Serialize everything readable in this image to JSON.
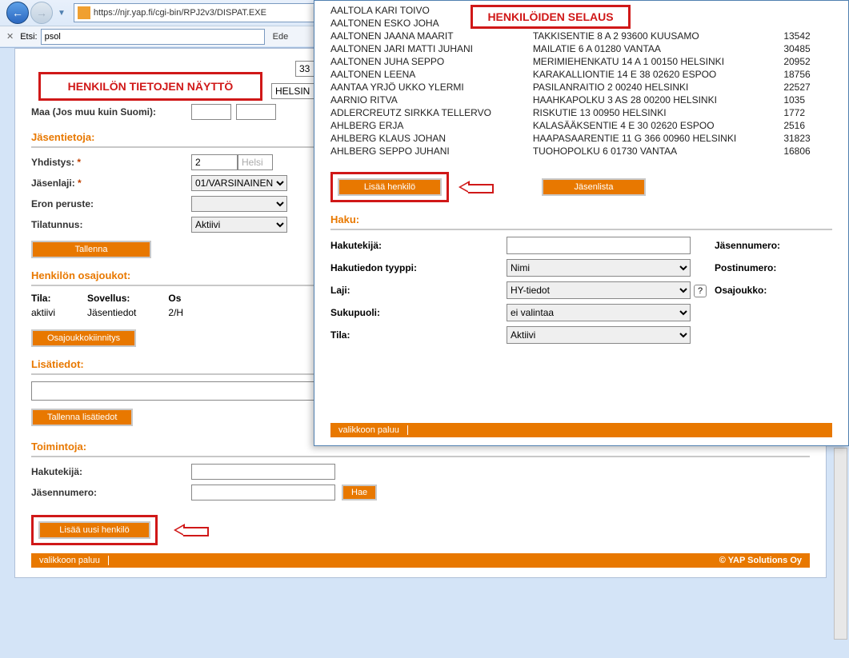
{
  "browser": {
    "url": "https://njr.yap.fi/cgi-bin/RPJ2v3/DISPAT.EXE",
    "find_label": "Etsi:",
    "find_value": "psol",
    "find_next": "Ede"
  },
  "callouts": {
    "left": "HENKILÖN TIETOJEN NÄYTTÖ",
    "right": "HENKILÖIDEN SELAUS"
  },
  "left": {
    "value33": "33",
    "valueHelsinki": "HELSIN",
    "maa_label": "Maa (Jos muu kuin Suomi):",
    "jasentietoja": "Jäsentietoja:",
    "yhdistys_label": "Yhdistys:",
    "yhdistys_value": "2",
    "yhdistys_hint": "Helsi",
    "jasenlaji_label": "Jäsenlaji:",
    "jasenlaji_value": "01/VARSINAINEN",
    "eron_label": "Eron peruste:",
    "tilatunnus_label": "Tilatunnus:",
    "tilatunnus_value": "Aktiivi",
    "tallenna": "Tallenna",
    "osajoukot": "Henkilön osajoukot:",
    "tila_h": "Tila:",
    "tila_v": "aktiivi",
    "sovellus_h": "Sovellus:",
    "sovellus_v": "Jäsentiedot",
    "os_h": "Os",
    "os_v": "2/H",
    "osajoukkokiinnitys": "Osajoukkokiinnitys",
    "lisatiedot": "Lisätiedot:",
    "tallenna_lisa": "Tallenna lisätiedot",
    "toimintoja": "Toimintoja:",
    "hakutekija": "Hakutekijä:",
    "jasennumero": "Jäsennumero:",
    "hae": "Hae",
    "lisaa_uusi": "Lisää uusi henkilö",
    "valikkoon": "valikkoon paluu",
    "copyright": "© YAP Solutions Oy"
  },
  "right": {
    "persons": [
      {
        "name": "AALTOLA KARI TOIVO",
        "addr": "",
        "num": ""
      },
      {
        "name": "AALTONEN ESKO JOHA",
        "addr": "",
        "num": ""
      },
      {
        "name": "AALTONEN JAANA MAARIT",
        "addr": "TAKKISENTIE 8 A 2 93600 KUUSAMO",
        "num": "13542"
      },
      {
        "name": "AALTONEN JARI MATTI JUHANI",
        "addr": "MAILATIE 6 A 01280 VANTAA",
        "num": "30485"
      },
      {
        "name": "AALTONEN JUHA SEPPO",
        "addr": "MERIMIEHENKATU 14 A 1 00150 HELSINKI",
        "num": "20952"
      },
      {
        "name": "AALTONEN LEENA",
        "addr": "KARAKALLIONTIE 14 E 38 02620 ESPOO",
        "num": "18756"
      },
      {
        "name": "AANTAA YRJÖ UKKO YLERMI",
        "addr": "PASILANRAITIO 2 00240 HELSINKI",
        "num": "22527"
      },
      {
        "name": "AARNIO RITVA",
        "addr": "HAAHKAPOLKU 3 AS 28 00200 HELSINKI",
        "num": "1035"
      },
      {
        "name": "ADLERCREUTZ SIRKKA TELLERVO",
        "addr": "RISKUTIE 13 00950 HELSINKI",
        "num": "1772"
      },
      {
        "name": "AHLBERG ERJA",
        "addr": "KALASÄÄKSENTIE 4 E 30 02620 ESPOO",
        "num": "2516"
      },
      {
        "name": "AHLBERG KLAUS JOHAN",
        "addr": "HAAPASAARENTIE 11 G 366 00960 HELSINKI",
        "num": "31823"
      },
      {
        "name": "AHLBERG SEPPO JUHANI",
        "addr": "TUOHOPOLKU 6 01730 VANTAA",
        "num": "16806"
      }
    ],
    "lisaa_henkilo": "Lisää henkilö",
    "jasenlista": "Jäsenlista",
    "haku": "Haku:",
    "hakutekija": "Hakutekijä:",
    "hakutiedon": "Hakutiedon tyyppi:",
    "hakutiedon_v": "Nimi",
    "laji": "Laji:",
    "laji_v": "HY-tiedot",
    "sukupuoli": "Sukupuoli:",
    "sukupuoli_v": "ei valintaa",
    "tila": "Tila:",
    "tila_v": "Aktiivi",
    "jasennumero": "Jäsennumero:",
    "postinumero": "Postinumero:",
    "osajoukko": "Osajoukko:",
    "valikkoon": "valikkoon paluu"
  }
}
